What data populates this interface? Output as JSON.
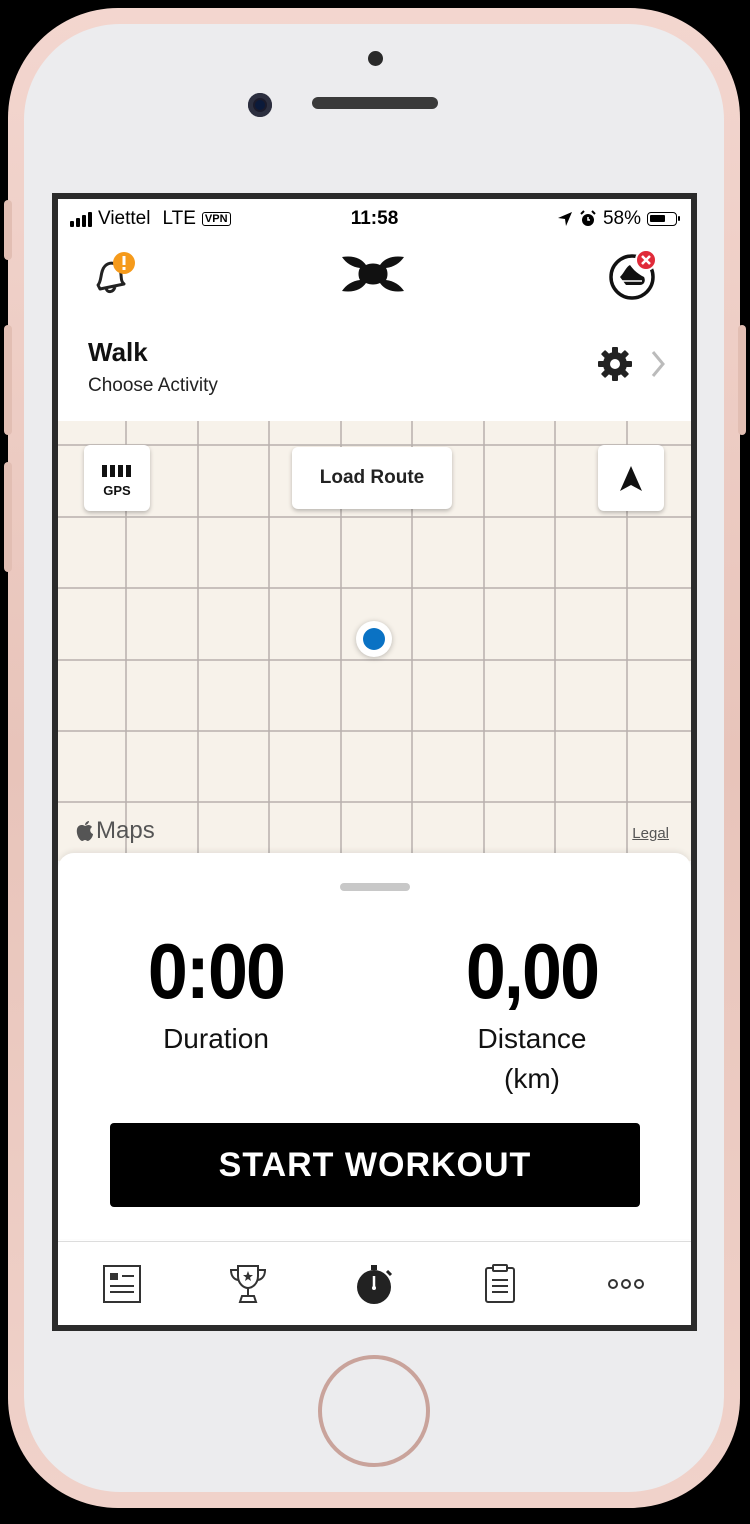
{
  "status_bar": {
    "carrier": "Viettel",
    "network": "LTE",
    "vpn": "VPN",
    "time": "11:58",
    "battery": "58%"
  },
  "activity": {
    "title": "Walk",
    "subtitle": "Choose Activity"
  },
  "map": {
    "gps_label": "GPS",
    "load_route_label": "Load Route",
    "attribution": "Maps",
    "legal_label": "Legal"
  },
  "stats": {
    "duration_value": "0:00",
    "duration_label": "Duration",
    "distance_value": "0,00",
    "distance_label": "Distance",
    "distance_unit": "(km)"
  },
  "start_button_label": "START WORKOUT",
  "tabs": [
    {
      "icon": "feed-icon"
    },
    {
      "icon": "trophy-icon"
    },
    {
      "icon": "stopwatch-icon"
    },
    {
      "icon": "clipboard-icon"
    },
    {
      "icon": "more-icon"
    }
  ],
  "colors": {
    "notification_badge": "#f59a1b",
    "error_badge": "#e02b3a",
    "location_dot": "#0a72c4",
    "map_background": "#f7f2ea",
    "map_grid": "#b8b0ad"
  }
}
